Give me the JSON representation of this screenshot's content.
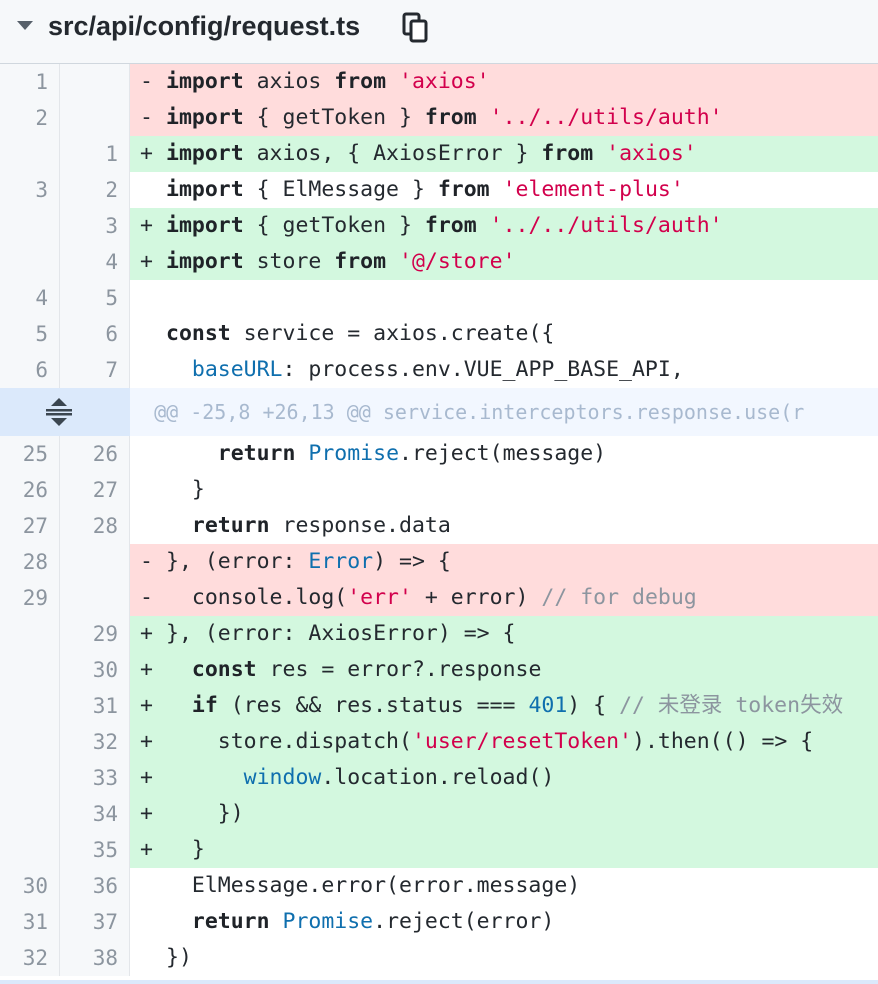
{
  "file": {
    "path": "src/api/config/request.ts",
    "collapse_icon": "triangle-down-icon",
    "copy_icon": "copy-icon"
  },
  "colors": {
    "deleted_bg": "#ffdcdc",
    "added_bg": "#d3f8df",
    "hunk_bg": "#f2f7ff",
    "gutter_bg": "#f6f8fa",
    "keyword": "#1f2328",
    "string": "#d2004c",
    "type": "#0f6fae",
    "comment": "#8c959f"
  },
  "diff": [
    {
      "kind": "del",
      "old": "1",
      "new": "",
      "marker": "-",
      "tokens": [
        [
          "kw",
          "import"
        ],
        [
          "p",
          " axios "
        ],
        [
          "kw",
          "from"
        ],
        [
          "p",
          " "
        ],
        [
          "str",
          "'axios'"
        ]
      ]
    },
    {
      "kind": "del",
      "old": "2",
      "new": "",
      "marker": "-",
      "tokens": [
        [
          "kw",
          "import"
        ],
        [
          "p",
          " { getToken } "
        ],
        [
          "kw",
          "from"
        ],
        [
          "p",
          " "
        ],
        [
          "str",
          "'../../utils/auth'"
        ]
      ]
    },
    {
      "kind": "add",
      "old": "",
      "new": "1",
      "marker": "+",
      "tokens": [
        [
          "kw",
          "import"
        ],
        [
          "p",
          " axios, { AxiosError } "
        ],
        [
          "kw",
          "from"
        ],
        [
          "p",
          " "
        ],
        [
          "str",
          "'axios'"
        ]
      ]
    },
    {
      "kind": "ctx",
      "old": "3",
      "new": "2",
      "marker": "",
      "tokens": [
        [
          "kw",
          "import"
        ],
        [
          "p",
          " { ElMessage } "
        ],
        [
          "kw",
          "from"
        ],
        [
          "p",
          " "
        ],
        [
          "str",
          "'element-plus'"
        ]
      ]
    },
    {
      "kind": "add",
      "old": "",
      "new": "3",
      "marker": "+",
      "tokens": [
        [
          "kw",
          "import"
        ],
        [
          "p",
          " { getToken } "
        ],
        [
          "kw",
          "from"
        ],
        [
          "p",
          " "
        ],
        [
          "str",
          "'../../utils/auth'"
        ]
      ]
    },
    {
      "kind": "add",
      "old": "",
      "new": "4",
      "marker": "+",
      "tokens": [
        [
          "kw",
          "import"
        ],
        [
          "p",
          " store "
        ],
        [
          "kw",
          "from"
        ],
        [
          "p",
          " "
        ],
        [
          "str",
          "'@/store'"
        ]
      ]
    },
    {
      "kind": "ctx",
      "old": "4",
      "new": "5",
      "marker": "",
      "tokens": []
    },
    {
      "kind": "ctx",
      "old": "5",
      "new": "6",
      "marker": "",
      "tokens": [
        [
          "kw",
          "const"
        ],
        [
          "p",
          " service = axios.create({"
        ]
      ]
    },
    {
      "kind": "ctx",
      "old": "6",
      "new": "7",
      "marker": "",
      "tokens": [
        [
          "p",
          "  "
        ],
        [
          "ty",
          "baseURL"
        ],
        [
          "p",
          ": process.env.VUE_APP_BASE_API,"
        ]
      ]
    },
    {
      "kind": "hunk",
      "text": "@@ -25,8 +26,13 @@ service.interceptors.response.use(r"
    },
    {
      "kind": "ctx",
      "old": "25",
      "new": "26",
      "marker": "",
      "tokens": [
        [
          "p",
          "    "
        ],
        [
          "kw",
          "return"
        ],
        [
          "p",
          " "
        ],
        [
          "ty",
          "Promise"
        ],
        [
          "p",
          ".reject(message)"
        ]
      ]
    },
    {
      "kind": "ctx",
      "old": "26",
      "new": "27",
      "marker": "",
      "tokens": [
        [
          "p",
          "  }"
        ]
      ]
    },
    {
      "kind": "ctx",
      "old": "27",
      "new": "28",
      "marker": "",
      "tokens": [
        [
          "p",
          "  "
        ],
        [
          "kw",
          "return"
        ],
        [
          "p",
          " response.data"
        ]
      ]
    },
    {
      "kind": "del",
      "old": "28",
      "new": "",
      "marker": "-",
      "tokens": [
        [
          "p",
          "}, (error: "
        ],
        [
          "ty",
          "Error"
        ],
        [
          "p",
          ") => {"
        ]
      ]
    },
    {
      "kind": "del",
      "old": "29",
      "new": "",
      "marker": "-",
      "tokens": [
        [
          "p",
          "  console.log("
        ],
        [
          "str",
          "'err'"
        ],
        [
          "p",
          " + error) "
        ],
        [
          "cm",
          "// for debug"
        ]
      ]
    },
    {
      "kind": "add",
      "old": "",
      "new": "29",
      "marker": "+",
      "tokens": [
        [
          "p",
          "}, (error: AxiosError) => {"
        ]
      ]
    },
    {
      "kind": "add",
      "old": "",
      "new": "30",
      "marker": "+",
      "tokens": [
        [
          "p",
          "  "
        ],
        [
          "kw",
          "const"
        ],
        [
          "p",
          " res = error?.response"
        ]
      ]
    },
    {
      "kind": "add",
      "old": "",
      "new": "31",
      "marker": "+",
      "tokens": [
        [
          "p",
          "  "
        ],
        [
          "kw",
          "if"
        ],
        [
          "p",
          " (res && res.status === "
        ],
        [
          "ty",
          "401"
        ],
        [
          "p",
          ") { "
        ],
        [
          "cm",
          "// 未登录 token失效"
        ]
      ]
    },
    {
      "kind": "add",
      "old": "",
      "new": "32",
      "marker": "+",
      "tokens": [
        [
          "p",
          "    store.dispatch("
        ],
        [
          "str",
          "'user/resetToken'"
        ],
        [
          "p",
          ").then(() => {"
        ]
      ]
    },
    {
      "kind": "add",
      "old": "",
      "new": "33",
      "marker": "+",
      "tokens": [
        [
          "p",
          "      "
        ],
        [
          "ty",
          "window"
        ],
        [
          "p",
          ".location.reload()"
        ]
      ]
    },
    {
      "kind": "add",
      "old": "",
      "new": "34",
      "marker": "+",
      "tokens": [
        [
          "p",
          "    })"
        ]
      ]
    },
    {
      "kind": "add",
      "old": "",
      "new": "35",
      "marker": "+",
      "tokens": [
        [
          "p",
          "  }"
        ]
      ]
    },
    {
      "kind": "ctx",
      "old": "30",
      "new": "36",
      "marker": "",
      "tokens": [
        [
          "p",
          "  ElMessage.error(error.message)"
        ]
      ]
    },
    {
      "kind": "ctx",
      "old": "31",
      "new": "37",
      "marker": "",
      "tokens": [
        [
          "p",
          "  "
        ],
        [
          "kw",
          "return"
        ],
        [
          "p",
          " "
        ],
        [
          "ty",
          "Promise"
        ],
        [
          "p",
          ".reject(error)"
        ]
      ]
    },
    {
      "kind": "ctx",
      "old": "32",
      "new": "38",
      "marker": "",
      "tokens": [
        [
          "p",
          "})"
        ]
      ]
    }
  ]
}
